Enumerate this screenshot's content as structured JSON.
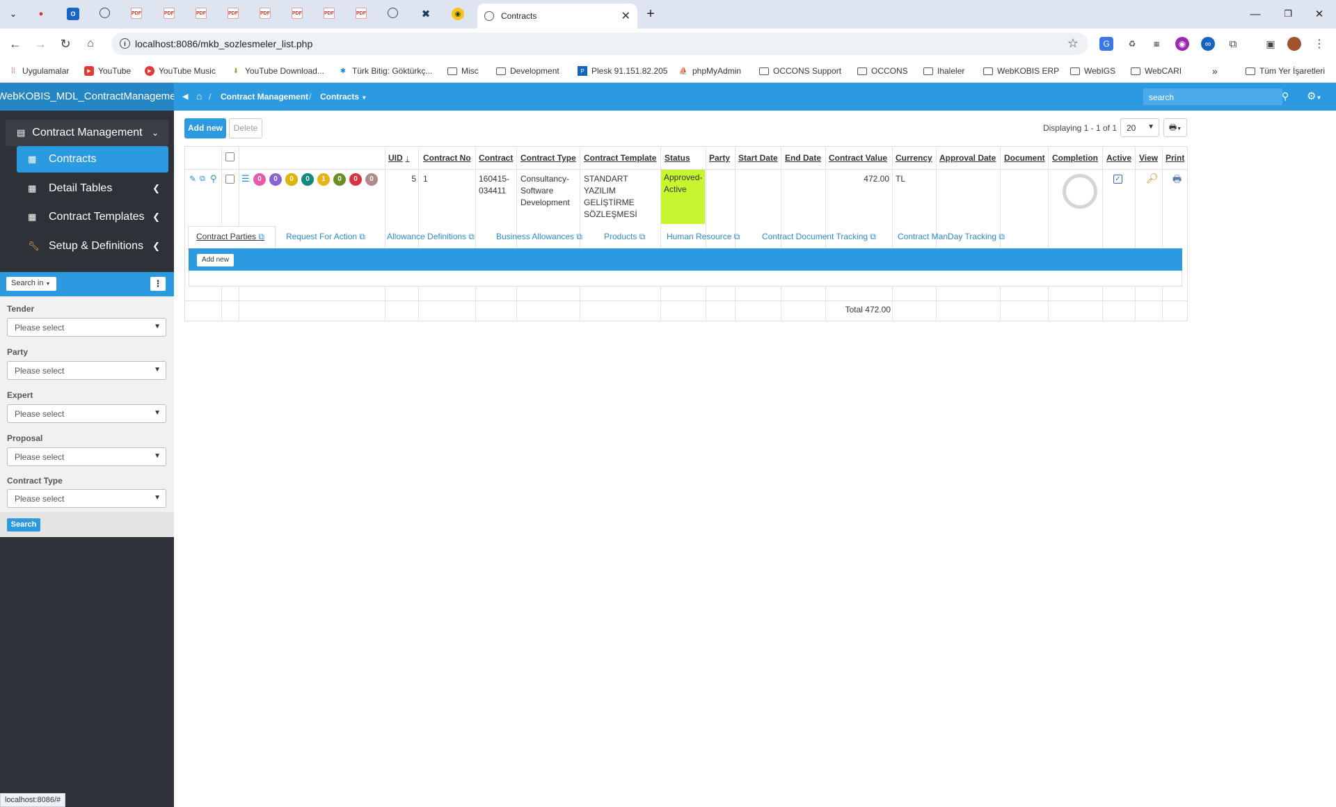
{
  "browser": {
    "active_tab_title": "Contracts",
    "url": "localhost:8086/mkb_sozlesmeler_list.php",
    "bookmarks": [
      "Uygulamalar",
      "YouTube",
      "YouTube Music",
      "YouTube Download...",
      "Türk Bitig: Göktürkç...",
      "Misc",
      "Development",
      "Plesk 91.151.82.205",
      "phpMyAdmin",
      "OCCONS Support",
      "OCCONS",
      "Ihaleler",
      "WebKOBIS ERP",
      "WebIGS",
      "WebCARI"
    ],
    "all_bookmarks": "Tüm Yer İşaretleri",
    "status_url": "localhost:8086/#"
  },
  "app": {
    "brand": "WebKOBIS_MDL_ContractManagement",
    "breadcrumb": [
      "Contract Management",
      "/",
      "Contracts"
    ],
    "search_placeholder": "search"
  },
  "sidebar": {
    "main_menu": "Contract Management",
    "items": [
      {
        "label": "Contracts"
      },
      {
        "label": "Detail Tables"
      },
      {
        "label": "Contract Templates"
      },
      {
        "label": "Setup & Definitions"
      }
    ]
  },
  "search_panel": {
    "search_in": "Search in",
    "filters": [
      {
        "label": "Tender",
        "value": "Please select"
      },
      {
        "label": "Party",
        "value": "Please select"
      },
      {
        "label": "Expert",
        "value": "Please select"
      },
      {
        "label": "Proposal",
        "value": "Please select"
      },
      {
        "label": "Contract Type",
        "value": "Please select"
      }
    ],
    "search_button": "Search"
  },
  "toolbar": {
    "add_new": "Add new",
    "delete": "Delete",
    "pager": "Displaying 1 - 1 of 1",
    "page_size": "20"
  },
  "grid": {
    "columns": [
      "UID",
      "Contract No",
      "Contract",
      "Contract Type",
      "Contract Template",
      "Status",
      "Party",
      "Start Date",
      "End Date",
      "Contract Value",
      "Currency",
      "Approval Date",
      "Document",
      "Completion",
      "Active",
      "View",
      "Print"
    ],
    "badges": [
      {
        "value": "0",
        "color": "#e65aa6"
      },
      {
        "value": "0",
        "color": "#8a63d2"
      },
      {
        "value": "0",
        "color": "#6a5ad8"
      },
      {
        "value": "0",
        "color": "#e0b400"
      },
      {
        "value": "0",
        "color": "#0f8a7f"
      },
      {
        "value": "1",
        "color": "#e8b21a"
      },
      {
        "value": "0",
        "color": "#6b8e23"
      },
      {
        "value": "0",
        "color": "#d9333f"
      },
      {
        "value": "0",
        "color": "#b08a8a"
      }
    ],
    "row": {
      "uid": "5",
      "contract_no": "1",
      "contract": [
        "160415-",
        "034411"
      ],
      "contract_type": [
        "Consultancy-",
        "Software",
        "Development"
      ],
      "contract_template": [
        "STANDART",
        "YAZILIM",
        "GELİŞTİRME",
        "SÖZLEŞMESİ"
      ],
      "status": [
        "Approved-",
        "Active"
      ],
      "contract_value": "472.00",
      "currency": "TL"
    },
    "total": "Total 472.00"
  },
  "subtabs": [
    "Contract Parties",
    "Request For Action",
    "Allowance Definitions",
    "Business Allowances",
    "Products",
    "Human Resource",
    "Contract Document Tracking",
    "Contract ManDay Tracking"
  ],
  "sub_add_new": "Add new"
}
